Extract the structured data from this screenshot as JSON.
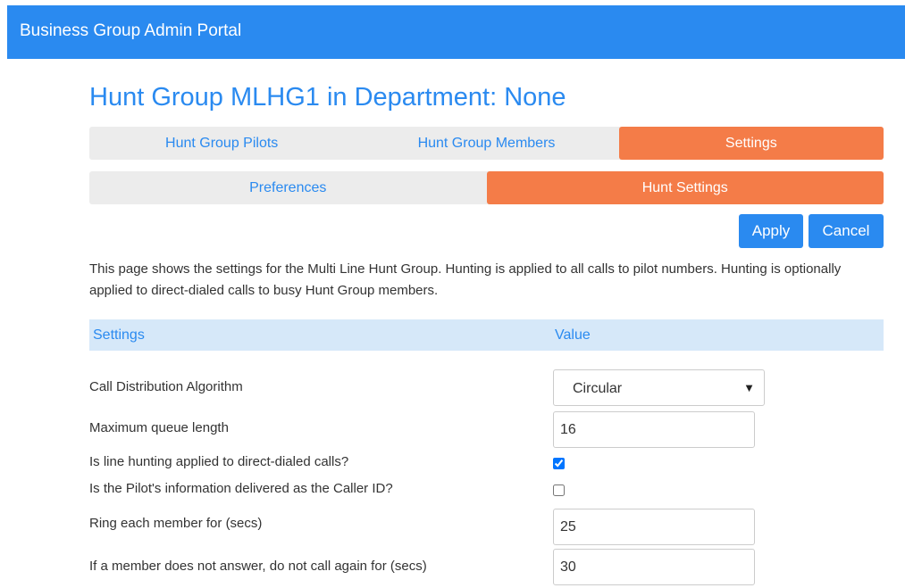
{
  "header": {
    "title": "Business Group Admin Portal"
  },
  "page": {
    "title": "Hunt Group MLHG1 in Department: None"
  },
  "main_tabs": [
    {
      "label": "Hunt Group Pilots",
      "active": false
    },
    {
      "label": "Hunt Group Members",
      "active": false
    },
    {
      "label": "Settings",
      "active": true
    }
  ],
  "sub_tabs": [
    {
      "label": "Preferences",
      "active": false
    },
    {
      "label": "Hunt Settings",
      "active": true
    }
  ],
  "actions": {
    "apply_label": "Apply",
    "cancel_label": "Cancel"
  },
  "description": "This page shows the settings for the Multi Line Hunt Group. Hunting is applied to all calls to pilot numbers. Hunting is optionally applied to direct-dialed calls to busy Hunt Group members.",
  "table": {
    "col_settings": "Settings",
    "col_value": "Value"
  },
  "settings": {
    "algorithm": {
      "label": "Call Distribution Algorithm",
      "value": "Circular"
    },
    "queue_length": {
      "label": "Maximum queue length",
      "value": "16"
    },
    "direct_dialed": {
      "label": "Is line hunting applied to direct-dialed calls?",
      "checked": true
    },
    "pilot_caller_id": {
      "label": "Is the Pilot's information delivered as the Caller ID?",
      "checked": false
    },
    "ring_each": {
      "label": "Ring each member for (secs)",
      "value": "25"
    },
    "no_answer": {
      "label": "If a member does not answer, do not call again for (secs)",
      "value": "30"
    }
  },
  "colors": {
    "brand": "#2a8af0",
    "active_tab": "#f47c48",
    "header_row": "#d6e8f9"
  }
}
